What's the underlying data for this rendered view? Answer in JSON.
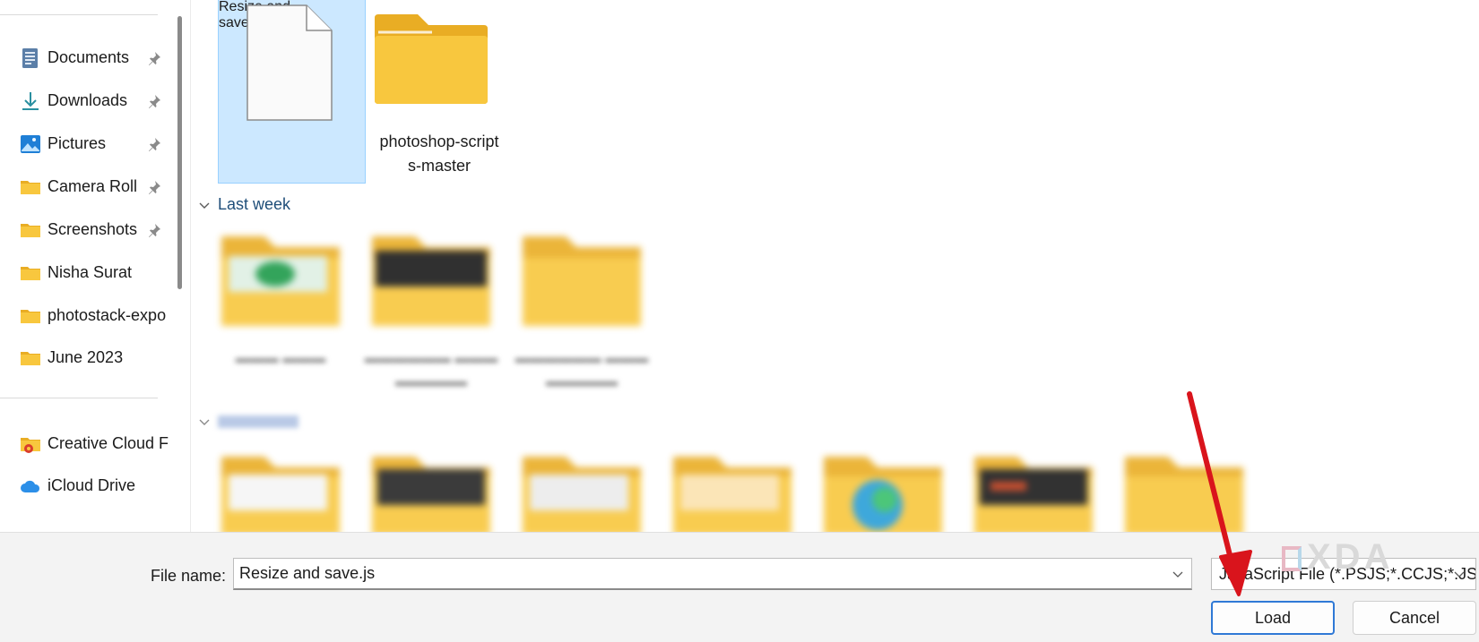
{
  "sidebar": {
    "items": [
      {
        "label": "Documents",
        "icon": "documents-icon",
        "pinned": true
      },
      {
        "label": "Downloads",
        "icon": "download-icon",
        "pinned": true
      },
      {
        "label": "Pictures",
        "icon": "pictures-icon",
        "pinned": true
      },
      {
        "label": "Camera Roll",
        "icon": "folder-icon",
        "pinned": true
      },
      {
        "label": "Screenshots",
        "icon": "folder-icon",
        "pinned": true
      },
      {
        "label": "Nisha Surat",
        "icon": "folder-icon",
        "pinned": false
      },
      {
        "label": "photostack-expo",
        "icon": "folder-icon",
        "pinned": false
      },
      {
        "label": "June 2023",
        "icon": "folder-icon",
        "pinned": false
      }
    ],
    "cloud_items": [
      {
        "label": "Creative Cloud F",
        "icon": "creative-cloud-icon"
      },
      {
        "label": "iCloud Drive",
        "icon": "icloud-icon"
      }
    ]
  },
  "main": {
    "files": [
      {
        "label_line1": "Resize and",
        "label_line2": "save.js",
        "icon": "file-icon",
        "selected": true
      },
      {
        "label_line1": "photoshop-script",
        "label_line2": "s-master",
        "icon": "folder-icon",
        "selected": false
      }
    ],
    "group_last_week": "Last week"
  },
  "footer": {
    "file_name_label": "File name:",
    "file_name_value": "Resize and save.js",
    "file_type": "JavaScript File (*.PSJS;*.CCJS;*.JS",
    "load_label": "Load",
    "cancel_label": "Cancel"
  },
  "watermark": "XDA",
  "colors": {
    "accent": "#2f79d6",
    "selection": "#cce8ff",
    "folder": "#f8c73e",
    "arrow": "#d9141c"
  }
}
